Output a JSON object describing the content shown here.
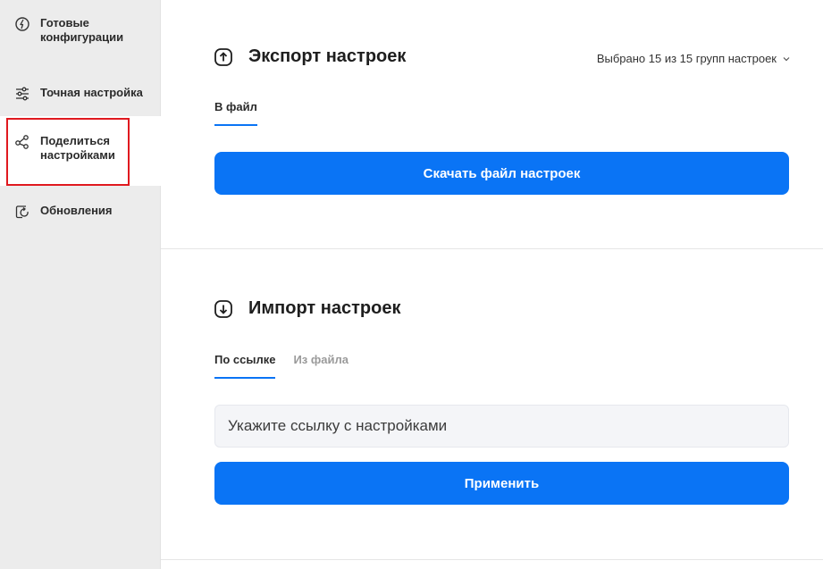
{
  "sidebar": {
    "items": [
      {
        "label": "Готовые конфигурации",
        "icon": "ready-config-icon"
      },
      {
        "label": "Точная настройка",
        "icon": "sliders-icon"
      },
      {
        "label": "Поделиться настройками",
        "icon": "share-icon",
        "active": true
      },
      {
        "label": "Обновления",
        "icon": "update-icon"
      }
    ]
  },
  "export": {
    "title": "Экспорт настроек",
    "icon": "arrow-up-circle-icon",
    "selection_label": "Выбрано 15 из 15 групп настроек",
    "tabs": [
      "В файл"
    ],
    "download_button": "Скачать файл настроек"
  },
  "import": {
    "title": "Импорт настроек",
    "icon": "arrow-down-circle-icon",
    "tabs": [
      "По ссылке",
      "Из файла"
    ],
    "url_placeholder": "Укажите ссылку с настройками",
    "apply_button": "Применить"
  },
  "colors": {
    "accent": "#0a74f5",
    "highlight": "#e0191f",
    "sidebar_bg": "#ececec"
  }
}
